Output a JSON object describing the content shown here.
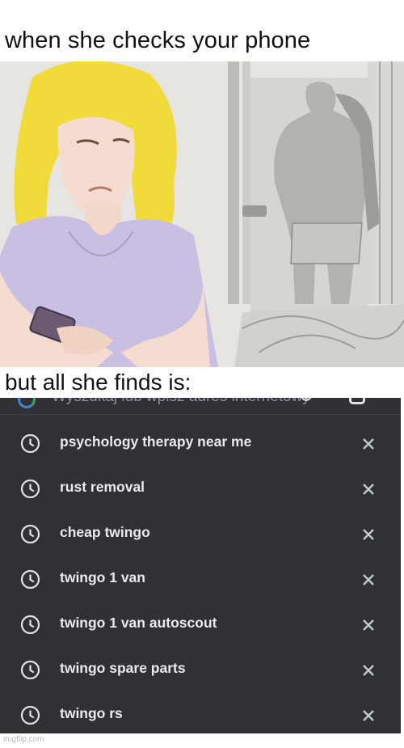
{
  "meme": {
    "top_caption": "when she checks your phone",
    "middle_caption": "but all she finds is:",
    "watermark": "imgflip.com"
  },
  "search": {
    "placeholder": "Wyszukaj lub wpisz adres internetowy"
  },
  "history": [
    {
      "label": "psychology therapy near me"
    },
    {
      "label": "rust removal"
    },
    {
      "label": "cheap twingo"
    },
    {
      "label": "twingo 1 van"
    },
    {
      "label": "twingo 1 van autoscout"
    },
    {
      "label": "twingo spare parts"
    },
    {
      "label": "twingo rs"
    }
  ],
  "colors": {
    "panel_bg": "#2f3134",
    "text": "#e8eaed",
    "icon": "#dfe1e5",
    "google_blue": "#4a7fd6"
  },
  "icons": {
    "history": "clock-icon",
    "remove": "close-icon"
  }
}
